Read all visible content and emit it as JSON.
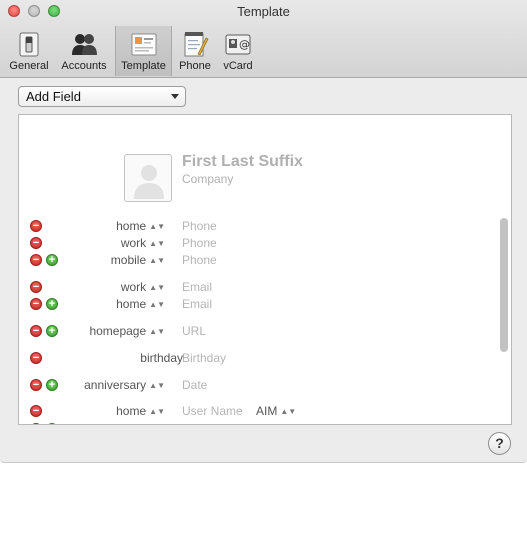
{
  "window": {
    "title": "Template"
  },
  "toolbar": {
    "items": [
      {
        "label": "General",
        "icon": "general-switch-icon"
      },
      {
        "label": "Accounts",
        "icon": "accounts-people-icon"
      },
      {
        "label": "Template",
        "icon": "template-card-icon",
        "selected": true
      },
      {
        "label": "Phone",
        "icon": "phone-notepad-icon"
      },
      {
        "label": "vCard",
        "icon": "vcard-icon"
      }
    ]
  },
  "add_field": {
    "label": "Add Field"
  },
  "card": {
    "name": "First Last Suffix",
    "company": "Company",
    "fields": [
      {
        "label": "home",
        "value": "Phone"
      },
      {
        "label": "work",
        "value": "Phone"
      },
      {
        "label": "mobile",
        "value": "Phone"
      },
      {
        "label": "work",
        "value": "Email"
      },
      {
        "label": "home",
        "value": "Email"
      },
      {
        "label": "homepage",
        "value": "URL"
      },
      {
        "label": "birthday",
        "value": "Birthday"
      },
      {
        "label": "anniversary",
        "value": "Date"
      },
      {
        "label": "home",
        "value": "User Name",
        "extra": "AIM"
      }
    ]
  },
  "help": {
    "label": "?"
  },
  "colors": {
    "remove": "#d0332d",
    "add": "#46a437",
    "placeholder": "#b5b5b5"
  }
}
